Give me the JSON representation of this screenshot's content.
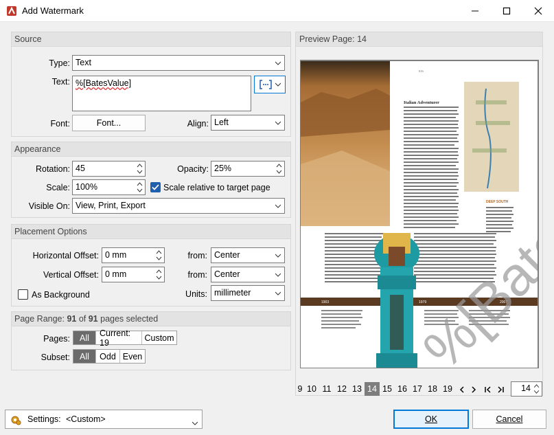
{
  "window": {
    "title": "Add Watermark"
  },
  "source": {
    "header": "Source",
    "type_label": "Type:",
    "type_value": "Text",
    "text_label": "Text:",
    "text_value": "%[BatesValue]",
    "font_label": "Font:",
    "font_button": "Font...",
    "align_label": "Align:",
    "align_value": "Left"
  },
  "appearance": {
    "header": "Appearance",
    "rotation_label": "Rotation:",
    "rotation_value": "45",
    "opacity_label": "Opacity:",
    "opacity_value": "25%",
    "scale_label": "Scale:",
    "scale_value": "100%",
    "scale_relative_label": "Scale relative to target page",
    "scale_relative_checked": true,
    "visible_on_label": "Visible On:",
    "visible_on_value": "View, Print, Export"
  },
  "placement": {
    "header": "Placement Options",
    "h_offset_label": "Horizontal Offset:",
    "h_offset_value": "0 mm",
    "h_from_label": "from:",
    "h_from_value": "Center",
    "v_offset_label": "Vertical Offset:",
    "v_offset_value": "0 mm",
    "v_from_label": "from:",
    "v_from_value": "Center",
    "as_background_label": "As Background",
    "as_background_checked": false,
    "units_label": "Units:",
    "units_value": "millimeter"
  },
  "page_range": {
    "header_prefix": "Page Range: ",
    "selected": "91",
    "of_text": " of ",
    "total": "91",
    "suffix": " pages selected",
    "pages_label": "Pages:",
    "pages_options": [
      "All",
      "Current: 19",
      "Custom"
    ],
    "pages_selected": "All",
    "subset_label": "Subset:",
    "subset_options": [
      "All",
      "Odd",
      "Even"
    ],
    "subset_selected": "All"
  },
  "preview": {
    "header": "Preview Page: 14",
    "page_number": "016",
    "article_title": "Italian Adventurer",
    "sidebar_title": "DEEP SOUTH",
    "timeline": [
      "1903",
      "1979",
      "2007"
    ],
    "pages": [
      "9",
      "10",
      "11",
      "12",
      "13",
      "14",
      "15",
      "16",
      "17",
      "18",
      "19"
    ],
    "current_page": "14",
    "page_input": "14"
  },
  "footer": {
    "settings_label": "Settings:",
    "settings_value": "<Custom>",
    "ok_label": "OK",
    "cancel_label": "Cancel"
  },
  "colors": {
    "accent": "#0078d7",
    "checkbox": "#1f5fad",
    "app_icon": "#c0392b",
    "watermark": "#9a9a9a"
  }
}
